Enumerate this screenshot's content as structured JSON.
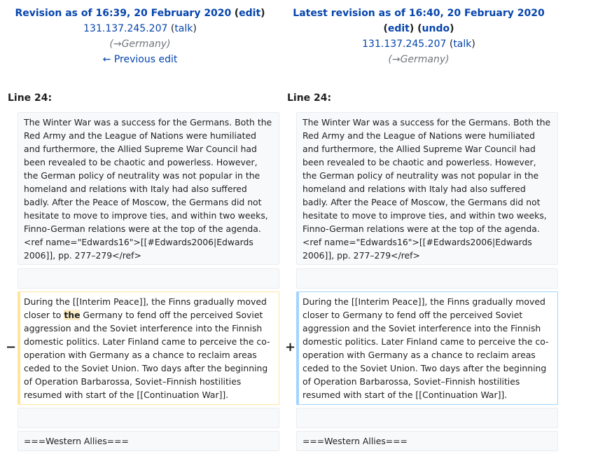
{
  "left": {
    "title": "Revision as of 16:39, 20 February 2020",
    "edit": "edit",
    "user": "131.137.245.207",
    "talk": "talk",
    "summary": "(→Germany)",
    "prev_edit": "← Previous edit",
    "line": "Line 24:"
  },
  "right": {
    "title": "Latest revision as of 16:40, 20 February 2020",
    "edit": "edit",
    "undo": "undo",
    "user": "131.137.245.207",
    "talk": "talk",
    "summary": "(→Germany)",
    "line": "Line 24:"
  },
  "context_para": "The Winter War was a success for the Germans. Both the Red Army and the League of Nations were humiliated and furthermore, the Allied Supreme War Council had been revealed to be chaotic and powerless. However, the German policy of neutrality was not popular in the homeland and relations with Italy had also suffered badly. After the Peace of Moscow, the Germans did not hesitate to move to improve ties, and within two weeks, Finno-German relations were at the top of the agenda.<ref name=\"Edwards16\">[[#Edwards2006|Edwards 2006]], pp. 277–279</ref>",
  "deleted_para": {
    "before": "During the [[Interim Peace]], the Finns gradually moved closer to ",
    "highlight": "the",
    "after": " Germany to fend off the perceived Soviet aggression and the Soviet interference into the Finnish domestic politics. Later Finland came to perceive the co-operation with Germany as a chance to reclaim areas ceded to the Soviet Union. Two days after the beginning of Operation Barbarossa, Soviet–Finnish hostilities resumed with start of the [[Continuation War]]."
  },
  "added_para": "During the [[Interim Peace]], the Finns gradually moved closer to Germany to fend off the perceived Soviet aggression and the Soviet interference into the Finnish domestic politics. Later Finland came to perceive the co-operation with Germany as a chance to reclaim areas ceded to the Soviet Union. Two days after the beginning of Operation Barbarossa, Soviet–Finnish hostilities resumed with start of the [[Continuation War]].",
  "minus": "−",
  "plus": "+",
  "section_heading": "===Western Allies==="
}
